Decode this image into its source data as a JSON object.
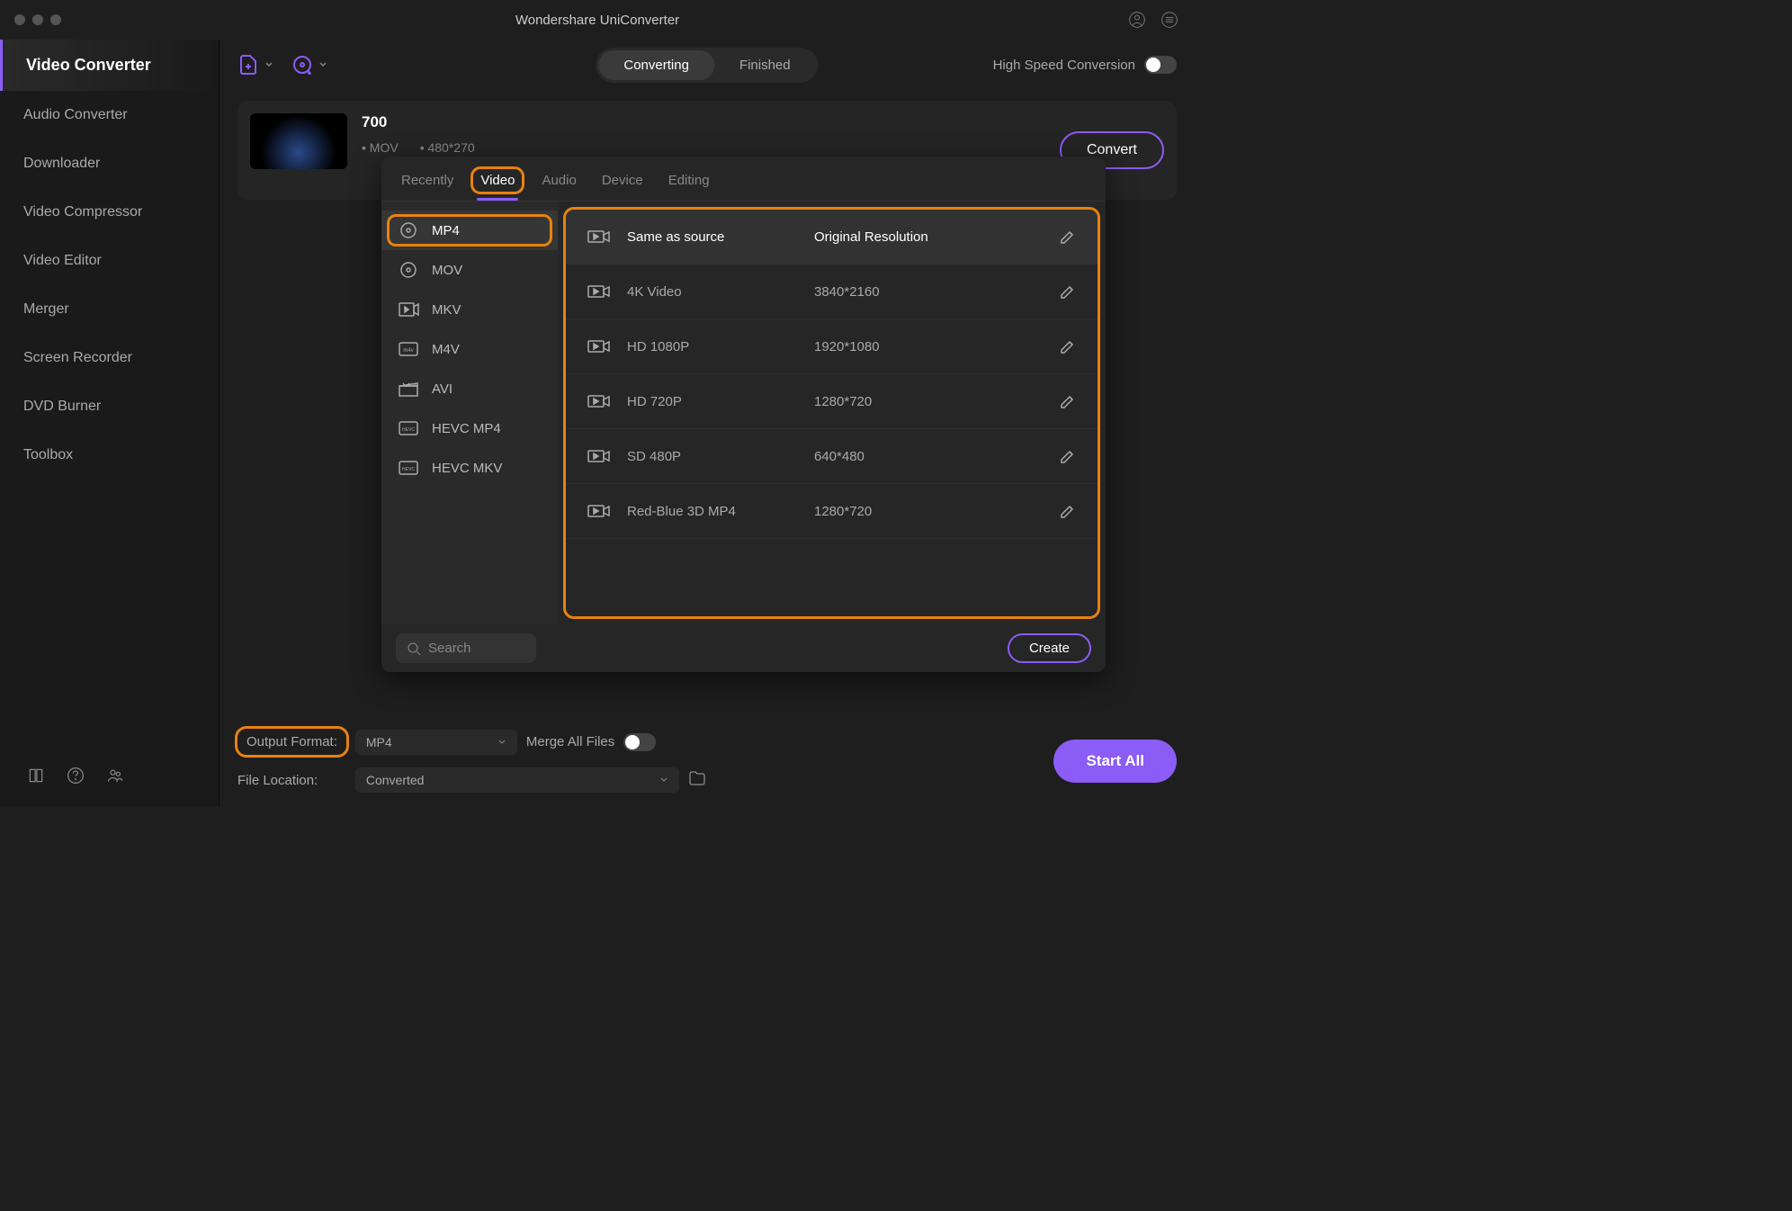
{
  "app_title": "Wondershare UniConverter",
  "sidebar": {
    "items": [
      {
        "label": "Video Converter",
        "active": true
      },
      {
        "label": "Audio Converter"
      },
      {
        "label": "Downloader"
      },
      {
        "label": "Video Compressor"
      },
      {
        "label": "Video Editor"
      },
      {
        "label": "Merger"
      },
      {
        "label": "Screen Recorder"
      },
      {
        "label": "DVD Burner"
      },
      {
        "label": "Toolbox"
      }
    ]
  },
  "toolbar": {
    "seg": {
      "converting": "Converting",
      "finished": "Finished"
    },
    "high_speed_label": "High Speed Conversion"
  },
  "file": {
    "name": "700",
    "format": "MOV",
    "resolution": "480*270",
    "convert_label": "Convert"
  },
  "popup": {
    "tabs": [
      "Recently",
      "Video",
      "Audio",
      "Device",
      "Editing"
    ],
    "active_tab": 1,
    "formats": [
      "MP4",
      "MOV",
      "MKV",
      "M4V",
      "AVI",
      "HEVC MP4",
      "HEVC MKV"
    ],
    "active_format": 0,
    "resolutions": [
      {
        "name": "Same as source",
        "value": "Original Resolution"
      },
      {
        "name": "4K Video",
        "value": "3840*2160"
      },
      {
        "name": "HD 1080P",
        "value": "1920*1080"
      },
      {
        "name": "HD 720P",
        "value": "1280*720"
      },
      {
        "name": "SD 480P",
        "value": "640*480"
      },
      {
        "name": "Red-Blue 3D MP4",
        "value": "1280*720"
      }
    ],
    "search_placeholder": "Search",
    "create_label": "Create"
  },
  "bottom": {
    "output_format_label": "Output Format:",
    "output_format_value": "MP4",
    "merge_label": "Merge All Files",
    "file_location_label": "File Location:",
    "file_location_value": "Converted",
    "start_all_label": "Start All"
  }
}
